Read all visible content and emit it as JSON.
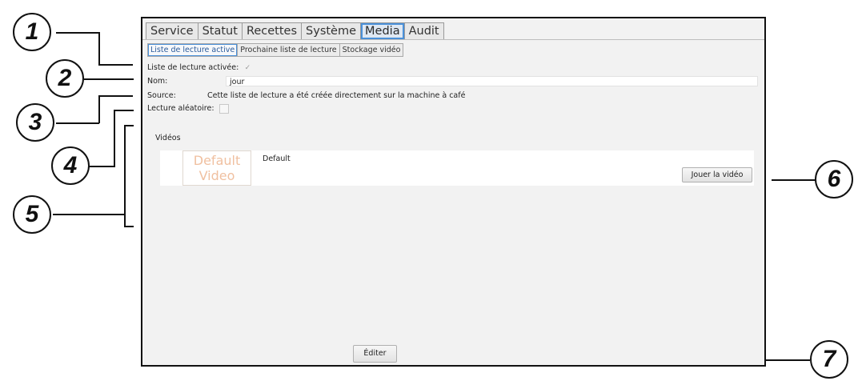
{
  "main_tabs": [
    "Service",
    "Statut",
    "Recettes",
    "Système",
    "Media",
    "Audit"
  ],
  "main_tab_active": "Media",
  "sub_tabs": [
    "Liste de lecture active",
    "Prochaine liste de lecture",
    "Stockage vidéo"
  ],
  "sub_tab_active": "Liste de lecture active",
  "form": {
    "playlist_active_label": "Liste de lecture activée:",
    "playlist_active_check": "✓",
    "name_label": "Nom:",
    "name_value": "jour",
    "source_label": "Source:",
    "source_value": "Cette liste de lecture a été créée directement sur la machine à café",
    "random_label": "Lecture aléatoire:"
  },
  "videos": {
    "section_label": "Vidéos",
    "items": [
      {
        "thumb_line1": "Default",
        "thumb_line2": "Video",
        "title": "Default",
        "play_label": "Jouer la vidéo"
      }
    ]
  },
  "edit_label": "Éditer",
  "callouts": [
    "1",
    "2",
    "3",
    "4",
    "5",
    "6",
    "7"
  ]
}
